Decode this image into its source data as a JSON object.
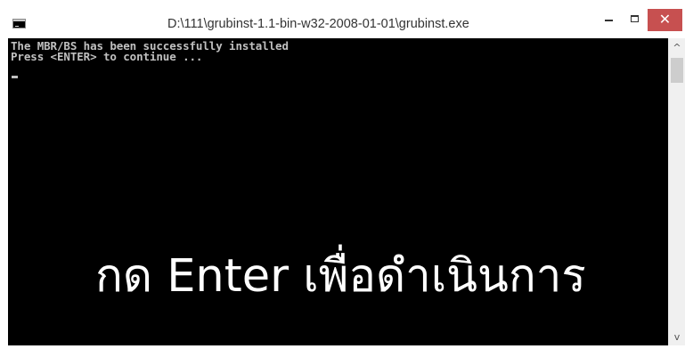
{
  "window": {
    "title": "D:\\111\\grubinst-1.1-bin-w32-2008-01-01\\grubinst.exe",
    "app_icon": "console-icon",
    "controls": {
      "minimize_icon": "minimize-icon",
      "maximize_icon": "maximize-icon",
      "close_label": "✕",
      "close_color": "#c75050"
    }
  },
  "console": {
    "lines": [
      "The MBR/BS has been successfully installed",
      "Press <ENTER> to continue ..."
    ],
    "background": "#000000",
    "text_color": "#c0c0c0"
  },
  "overlay": {
    "caption": "กด Enter เพื่อดำเนินการ"
  },
  "scrollbar": {
    "up_arrow": "^",
    "down_arrow": "v"
  }
}
